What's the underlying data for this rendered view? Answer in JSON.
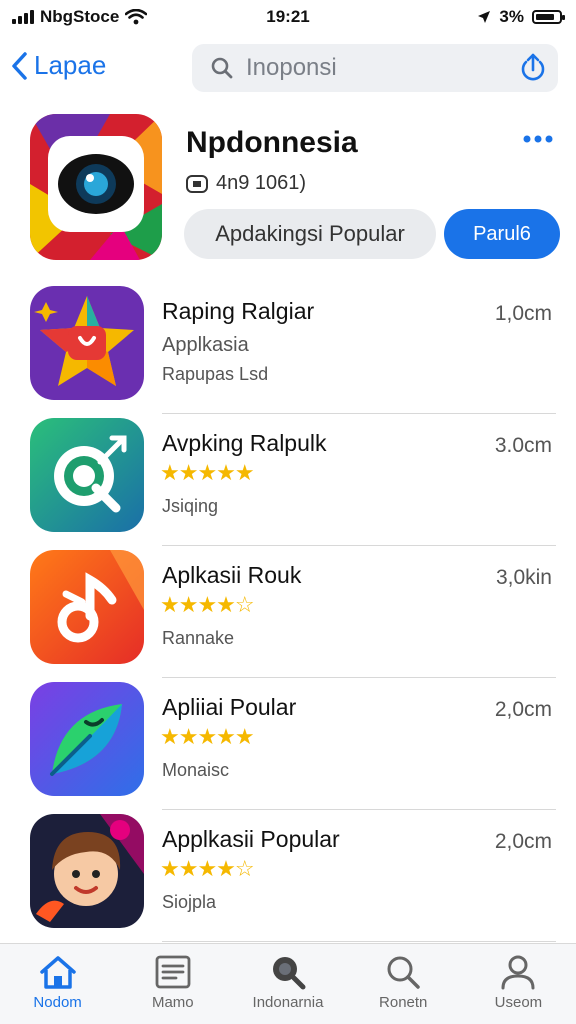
{
  "status": {
    "carrier": "NbgStoce",
    "time": "19:21",
    "battery": "3%"
  },
  "nav": {
    "back_label": "Lapae",
    "search_value": "Inoponsi"
  },
  "hero": {
    "title": "Npdonnesia",
    "meta": "4n9 1061)",
    "primary_label": "Apdakingsi Popular",
    "action_label": "Parul6"
  },
  "apps": [
    {
      "name": "Raping Ralgiar",
      "subtitle": "Applkasia",
      "tag": "Rapupas Lsd",
      "size": "1,0cm",
      "rating": null
    },
    {
      "name": "Avpking Ralpulk",
      "subtitle": "",
      "tag": "Jsiqing",
      "size": "3.0cm",
      "rating": "★★★★★"
    },
    {
      "name": "Aplkasii Rouk",
      "subtitle": "",
      "tag": "Rannake",
      "size": "3,0kin",
      "rating": "★★★★☆"
    },
    {
      "name": "Apliiai Poular",
      "subtitle": "",
      "tag": "Monaisc",
      "size": "2,0cm",
      "rating": "★★★★★"
    },
    {
      "name": "Applkasii Popular",
      "subtitle": "",
      "tag": "Siojpla",
      "size": "2,0cm",
      "rating": "★★★★☆"
    }
  ],
  "tabs": [
    {
      "label": "Nodom",
      "icon": "home-icon",
      "active": true
    },
    {
      "label": "Mamo",
      "icon": "list-icon",
      "active": false
    },
    {
      "label": "Indonarnia",
      "icon": "search-filled-icon",
      "active": false
    },
    {
      "label": "Ronetn",
      "icon": "search-icon",
      "active": false
    },
    {
      "label": "Useom",
      "icon": "person-icon",
      "active": false
    }
  ],
  "colors": {
    "accent": "#1a73e8",
    "star": "#f5b800"
  }
}
